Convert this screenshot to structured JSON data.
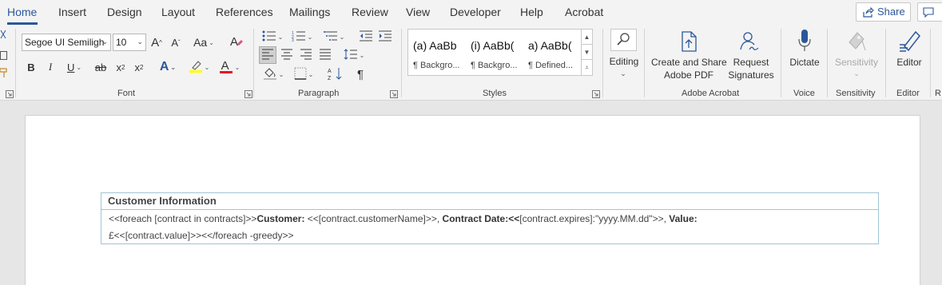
{
  "tabs": [
    "Home",
    "Insert",
    "Design",
    "Layout",
    "References",
    "Mailings",
    "Review",
    "View",
    "Developer",
    "Help",
    "Acrobat"
  ],
  "share_label": "Share",
  "font": {
    "name": "Segoe UI Semiligh",
    "size": "10"
  },
  "font_buttons": {
    "grow": "A",
    "shrink": "A",
    "change_case": "Aa",
    "bold": "B",
    "italic": "I",
    "underline": "U",
    "strike": "ab",
    "subscript": "x",
    "superscript": "x",
    "text_effects": "A",
    "font_color": "A"
  },
  "styles": [
    {
      "preview": "(a)  AaBb",
      "name": "¶ Backgro..."
    },
    {
      "preview": "(i)  AaBb(",
      "name": "¶ Backgro..."
    },
    {
      "preview": "a)  AaBb(",
      "name": "¶ Defined..."
    }
  ],
  "groups": {
    "font": "Font",
    "paragraph": "Paragraph",
    "styles": "Styles",
    "adobe": "Adobe Acrobat",
    "voice": "Voice",
    "sensitivity": "Sensitivity",
    "editor": "Editor",
    "cut": "R"
  },
  "big_buttons": {
    "editing": "Editing",
    "create_share_line1": "Create and Share",
    "create_share_line2": "Adobe PDF",
    "request_line1": "Request",
    "request_line2": "Signatures",
    "dictate": "Dictate",
    "sensitivity": "Sensitivity",
    "editor": "Editor"
  },
  "paragraph_mark": "¶",
  "document": {
    "table_header": "Customer Information",
    "row1": {
      "p1": "<<foreach [contract in contracts]>>",
      "b1": "Customer:",
      "p2": " <<[contract.customerName]>>, ",
      "b2": "Contract Date:<<",
      "p3": "[contract.expires]:\"yyyy.MM.dd\">>, ",
      "b3": "Value:"
    },
    "row2": "£<<[contract.value]>><</foreach -greedy>>"
  },
  "colors": {
    "accent": "#2b579a",
    "table_border": "#9fc5d6",
    "font_color_bar": "#e81123",
    "highlight_bar": "#ffff00"
  }
}
